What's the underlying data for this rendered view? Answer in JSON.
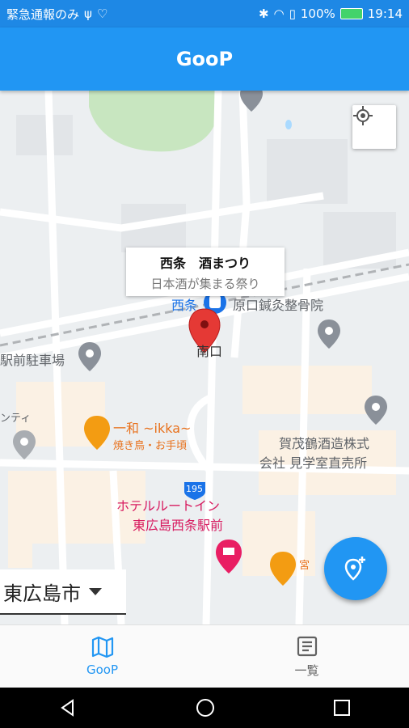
{
  "status_bar": {
    "left_text": "緊急通報のみ",
    "usb_icon": "usb-icon",
    "heart_icon": "heart-icon",
    "battery_percent": "100%",
    "time": "19:14"
  },
  "app_bar": {
    "title": "GooP"
  },
  "map": {
    "info_window": {
      "title": "西条　酒まつり",
      "subtitle": "日本酒が集まる祭り"
    },
    "labels": {
      "saijo_station": "西条",
      "clinic": "原口鍼灸整骨院",
      "minamiguchi": "南口",
      "parking": "駅前駐車場",
      "nti": "ンティ",
      "ikka": "一和 ~ikka~",
      "ikka_sub": "焼き鳥・お手頃",
      "kamotsuru_1": "賀茂鶴酒造株式",
      "kamotsuru_2": "会社 見学室直売所",
      "route": "195",
      "hotel_1": "ホテルルートイン",
      "hotel_2": "東広島西条駅前",
      "partial": "宮"
    }
  },
  "city_select": {
    "value": "東広島市"
  },
  "bottom_nav": {
    "items": [
      {
        "label": "GooP",
        "icon": "map-icon"
      },
      {
        "label": "一覧",
        "icon": "list-icon"
      }
    ]
  },
  "colors": {
    "primary": "#2196f3",
    "status": "#1e88e5",
    "marker": "#e53935"
  }
}
